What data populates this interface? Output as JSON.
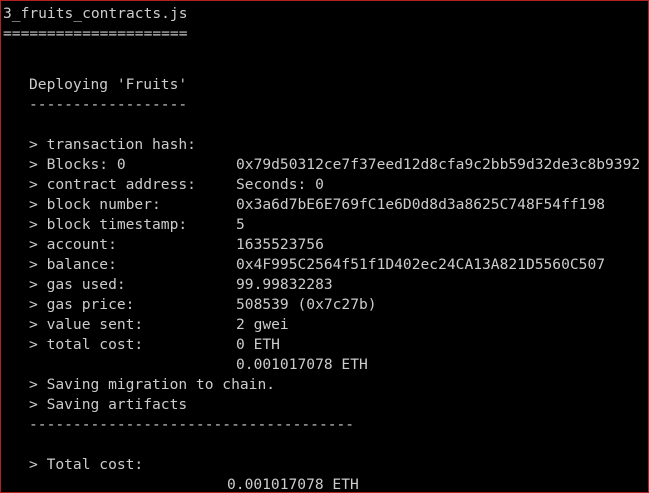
{
  "terminal": {
    "colors": {
      "background": "#000000",
      "text": "#cccccc",
      "border": "#b22222"
    },
    "file_heading": "3_fruits_contracts.js",
    "file_underline": "=====================",
    "deploying": "Deploying 'Fruits'",
    "deploy_underline": "------------------",
    "rows": [
      {
        "label": "> transaction hash:",
        "value": "0x79d50312ce7f37eed12d8cfa9c2bb59d32de3c8b9392"
      },
      {
        "label": "> Blocks: 0",
        "value": "Seconds: 0"
      },
      {
        "label": "> contract address:",
        "value": "0x3a6d7bE6E769fC1e6D0d8d3a8625C748F54ff198"
      },
      {
        "label": "> block number:",
        "value": "5"
      },
      {
        "label": "> block timestamp:",
        "value": "1635523756"
      },
      {
        "label": "> account:",
        "value": "0x4F995C2564f51f1D402ec24CA13A821D5560C507"
      },
      {
        "label": "> balance:",
        "value": "99.99832283"
      },
      {
        "label": "> gas used:",
        "value": "508539 (0x7c27b)"
      },
      {
        "label": "> gas price:",
        "value": "2 gwei"
      },
      {
        "label": "> value sent:",
        "value": "0 ETH"
      },
      {
        "label": "> total cost:",
        "value": "0.001017078 ETH"
      }
    ],
    "saving_migration": "> Saving migration to chain.",
    "saving_artifacts": "> Saving artifacts",
    "summary_underline": "-------------------------------------",
    "summary_label": "> Total cost:",
    "summary_value": "0.001017078 ETH"
  }
}
